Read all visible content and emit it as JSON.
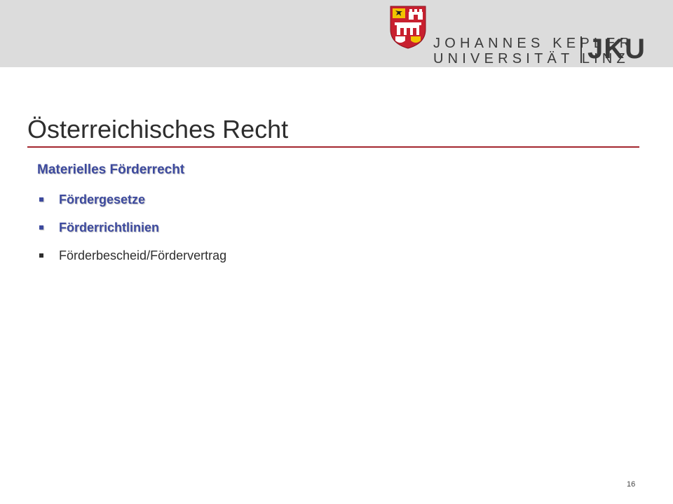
{
  "header": {
    "university_line1": "JOHANNES KEPLER",
    "university_line2": "UNIVERSITÄT LINZ",
    "jku_mark": "JKU"
  },
  "slide": {
    "title": "Österreichisches Recht",
    "subheading": "Materielles Förderrecht",
    "bullets": [
      {
        "text": "Fördergesetze",
        "emphasized": true
      },
      {
        "text": "Förderrichtlinien",
        "emphasized": true
      },
      {
        "text": "Förderbescheid/Fördervertrag",
        "emphasized": false
      }
    ]
  },
  "footer": {
    "page_number": "16"
  },
  "colors": {
    "header_band": "#dcdcdc",
    "title_rule": "#a3262e",
    "accent_blue": "#3d4a9e",
    "crest_red": "#c8202f",
    "crest_yellow": "#f2c400"
  }
}
